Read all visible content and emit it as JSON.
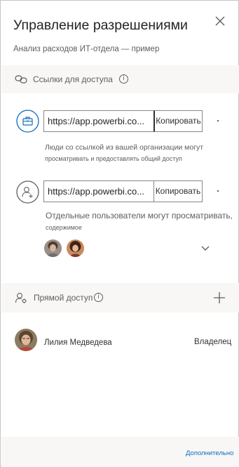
{
  "panel": {
    "title": "Управление разрешениями",
    "subtitle": "Анализ расходов ИТ-отдела — пример"
  },
  "links_section": {
    "label": "Ссылки для доступа",
    "items": [
      {
        "url": "https://app.powerbi.co...",
        "copy_label": "Копировать",
        "description_line1": "Люди со ссылкой из вашей организации могут",
        "description_line2": "просматривать и предоставлять общий доступ",
        "icon": "briefcase-icon"
      },
      {
        "url": "https://app.powerbi.co...",
        "copy_label": "Копировать",
        "description_line1": "Отдельные пользователи могут просматривать,",
        "description_line2": "содержимое",
        "icon": "add-person-icon"
      }
    ]
  },
  "direct_access": {
    "label": "Прямой доступ",
    "people": [
      {
        "name": "Лилия Медведева",
        "role": "Владелец"
      }
    ]
  },
  "footer": {
    "more_label": "Дополнительно"
  },
  "colors": {
    "accent": "#0f6cbd",
    "link_icon_blue": "#0f6cbd",
    "section_bg": "#f8f7f6",
    "border": "#8a8886"
  }
}
